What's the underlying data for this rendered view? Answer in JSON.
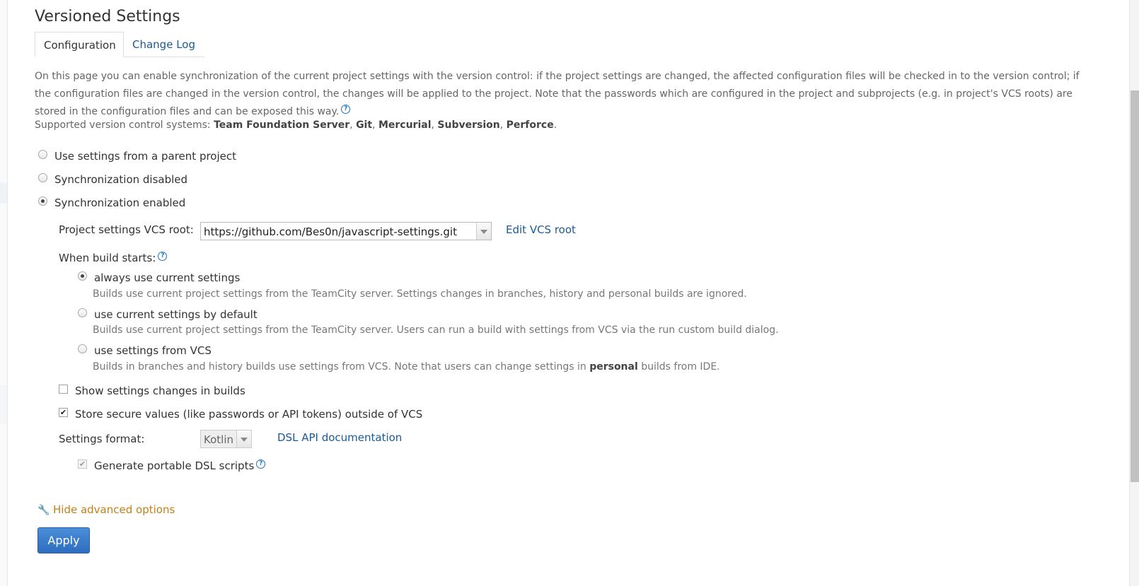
{
  "page": {
    "title": "Versioned Settings",
    "tabs": [
      {
        "label": "Configuration",
        "active": true
      },
      {
        "label": "Change Log",
        "active": false
      }
    ],
    "description": "On this page you can enable synchronization of the current project settings with the version control: if the project settings are changed, the affected configuration files will be checked in to the version control; if the configuration files are changed in the version control, the changes will be applied to the project. Note that the passwords which are configured in the project and subprojects (e.g. in project's VCS roots) are stored in the configuration files and can be exposed this way.",
    "help_icon": "question-circle-icon",
    "supported_prefix": "Supported version control systems:",
    "supported_systems": [
      "Team Foundation Server",
      "Git",
      "Mercurial",
      "Subversion",
      "Perforce"
    ],
    "supported_separator": ", ",
    "supported_suffix": "."
  },
  "sync_options": [
    {
      "label": "Use settings from a parent project",
      "checked": false
    },
    {
      "label": "Synchronization disabled",
      "checked": false
    },
    {
      "label": "Synchronization enabled",
      "checked": true
    }
  ],
  "vcs_root": {
    "label": "Project settings VCS root:",
    "value": "https://github.com/Bes0n/javascript-settings.git",
    "edit_link": "Edit VCS root"
  },
  "build_starts": {
    "label": "When build starts:",
    "options": [
      {
        "label": "always use current settings",
        "checked": true,
        "description": "Builds use current project settings from the TeamCity server. Settings changes in branches, history and personal builds are ignored."
      },
      {
        "label": "use current settings by default",
        "checked": false,
        "description": "Builds use current project settings from the TeamCity server. Users can run a build with settings from VCS via the run custom build dialog."
      },
      {
        "label": "use settings from VCS",
        "checked": false,
        "description_prefix": "Builds in branches and history builds use settings from VCS. Note that users can change settings in ",
        "description_bold": "personal",
        "description_suffix": " builds from IDE."
      }
    ]
  },
  "checkboxes": {
    "show_changes": {
      "label": "Show settings changes in builds",
      "checked": false
    },
    "store_secure": {
      "label": "Store secure values (like passwords or API tokens) outside of VCS",
      "checked": true
    }
  },
  "settings_format": {
    "label": "Settings format:",
    "value": "Kotlin",
    "doc_link": "DSL API documentation",
    "portable": {
      "label": "Generate portable DSL scripts",
      "checked": true,
      "disabled": true
    }
  },
  "advanced_toggle": {
    "label": "Hide advanced options",
    "icon": "wrench-icon"
  },
  "apply_button": {
    "label": "Apply"
  },
  "colors": {
    "link": "#1a5a96",
    "advanced": "#c47e17",
    "button": "#3a7dcc"
  }
}
